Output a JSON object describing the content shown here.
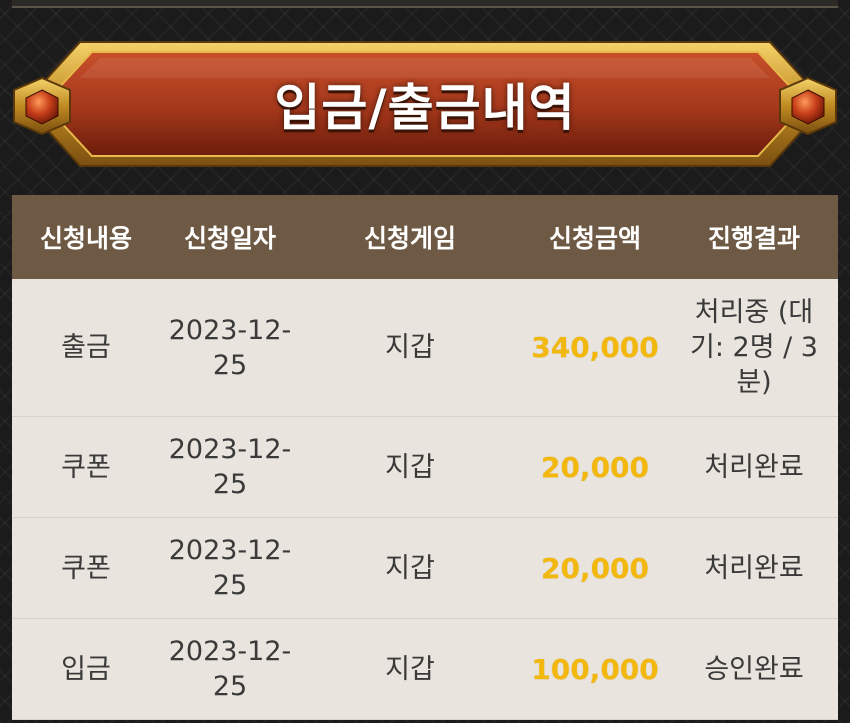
{
  "banner": {
    "title": "입금/출금내역"
  },
  "table": {
    "headers": [
      "신청내용",
      "신청일자",
      "신청게임",
      "신청금액",
      "진행결과"
    ],
    "rows": [
      {
        "type": "출금",
        "date": "2023-12-25",
        "game": "지갑",
        "amount": "340,000",
        "status": "처리중 (대기: 2명 / 3분)"
      },
      {
        "type": "쿠폰",
        "date": "2023-12-25",
        "game": "지갑",
        "amount": "20,000",
        "status": "처리완료"
      },
      {
        "type": "쿠폰",
        "date": "2023-12-25",
        "game": "지갑",
        "amount": "20,000",
        "status": "처리완료"
      },
      {
        "type": "입금",
        "date": "2023-12-25",
        "game": "지갑",
        "amount": "100,000",
        "status": "승인완료"
      }
    ]
  },
  "colors": {
    "header_bg": "#6e5a44",
    "row_bg": "#e9e4dd",
    "amount": "#f3b80d",
    "banner_red": "#a4371b",
    "banner_gold": "#c99a2e"
  }
}
